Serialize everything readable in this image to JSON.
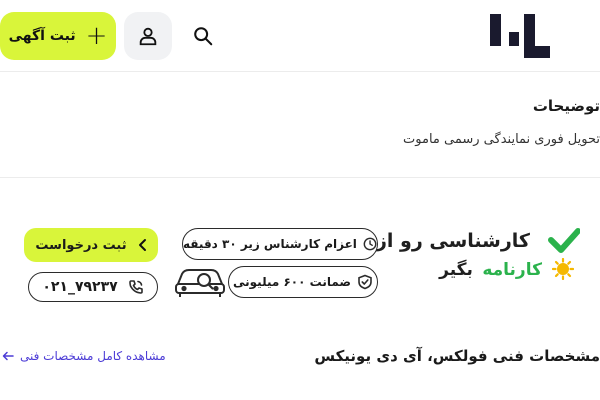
{
  "header": {
    "post_ad_label": "ثبت آگهی",
    "logo_icon": "divar-logo-icon",
    "user_icon": "user-icon",
    "search_icon": "search-icon"
  },
  "description": {
    "title": "توضیحات",
    "text": "تحویل فوری نمایندگی رسمی ماموت"
  },
  "karnameh": {
    "line1": "کارشناسی رو از",
    "brand": "کارنامه",
    "take": "بگیر",
    "brand_color": "#2bb24c",
    "time_pill": "اعزام کارشناس زیر ۳۰ دقیقه",
    "guarantee_pill": "ضمانت ۶۰۰ میلیونی",
    "request_label": "ثبت درخواست",
    "phone_number": "۰۲۱_۷۹۲۳۷"
  },
  "specs": {
    "title": "مشخصات فنی فولکس، آی دی یونیکس",
    "link_label": "مشاهده کامل مشخصات فنی"
  },
  "colors": {
    "accent": "#d9f53a",
    "link": "#4b3bd6"
  }
}
